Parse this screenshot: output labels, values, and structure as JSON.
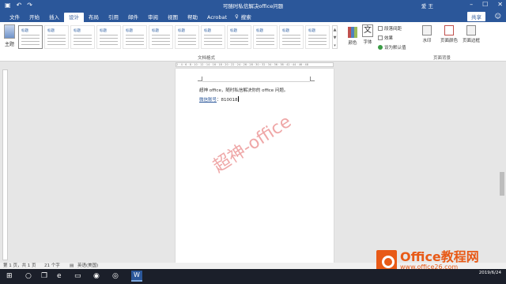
{
  "titlebar": {
    "title": "可随时私信解决office问题",
    "user": "爱 王",
    "undo_label": "↶",
    "redo_label": "↷",
    "save_label": "▣"
  },
  "tabs": [
    {
      "label": "文件"
    },
    {
      "label": "开始"
    },
    {
      "label": "插入"
    },
    {
      "label": "设计"
    },
    {
      "label": "布局"
    },
    {
      "label": "引用"
    },
    {
      "label": "邮件"
    },
    {
      "label": "审阅"
    },
    {
      "label": "视图"
    },
    {
      "label": "帮助"
    },
    {
      "label": "Acrobat"
    }
  ],
  "active_tab": "设计",
  "search_label": "搜索",
  "share_label": "共享",
  "ribbon": {
    "theme_label": "主题",
    "styles": [
      {
        "title": "标题"
      },
      {
        "title": "标题"
      },
      {
        "title": "标题"
      },
      {
        "title": "标题"
      },
      {
        "title": "标题"
      },
      {
        "title": "标题"
      },
      {
        "title": "标题"
      },
      {
        "title": "标题"
      },
      {
        "title": "标题"
      },
      {
        "title": "标题"
      },
      {
        "title": "标题"
      },
      {
        "title": "标题"
      }
    ],
    "colors_label": "颜色",
    "fonts_label": "字体",
    "fonts_glyph": "文",
    "paragraph_spacing_label": "段落间距",
    "effects_label": "效果",
    "set_default_label": "设为默认值",
    "watermark_label": "水印",
    "page_color_label": "页面颜色",
    "page_borders_label": "页面边框",
    "group_doc_format": "文档格式",
    "group_page_bg": "页面背景"
  },
  "ruler": {
    "ticks": "2 · 4 · 6 · 8 · 10 · 12 · 14 · 16 · 18 · 20 · 22 · 24 · 26 · 28 · 30 · 32 · 34 · 36 · 38 · 42 · 44 · 46 · 48"
  },
  "document": {
    "line1": "超神 office，随时私信解决你的 office 问题。",
    "contact_label": "微信账号",
    "contact_value": "：810018",
    "watermark": "超神-office"
  },
  "statusbar": {
    "page": "第 1 页，共 1 页",
    "words": "21 个字",
    "language": "英语(美国)"
  },
  "taskbar": {
    "time": "",
    "date": "2019/6/24"
  },
  "logo": {
    "text": "Office教程网",
    "url": "www.office26.com"
  }
}
